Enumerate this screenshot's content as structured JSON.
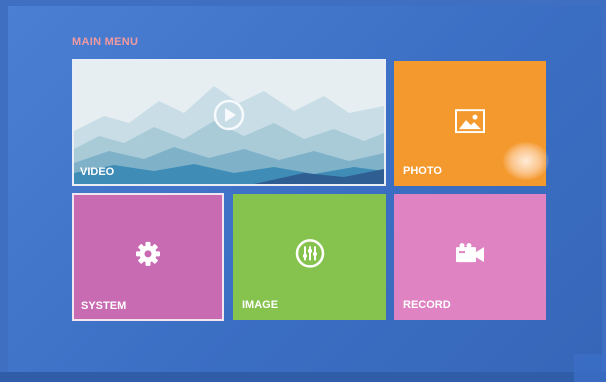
{
  "menu": {
    "title": "MAIN MENU"
  },
  "tiles": {
    "video": {
      "label": "VIDEO",
      "icon": "play-icon",
      "color": "#dfe8ee"
    },
    "photo": {
      "label": "PHOTO",
      "icon": "picture-icon",
      "color": "#f4992e"
    },
    "system": {
      "label": "SYSTEM",
      "icon": "gear-icon",
      "color": "#c86bb3"
    },
    "image": {
      "label": "IMAGE",
      "icon": "equalizer-icon",
      "color": "#86c34e"
    },
    "record": {
      "label": "RECORD",
      "icon": "camcorder-icon",
      "color": "#df83c2"
    }
  },
  "colors": {
    "background": "#3f6fc1",
    "title": "#f29aa0"
  }
}
